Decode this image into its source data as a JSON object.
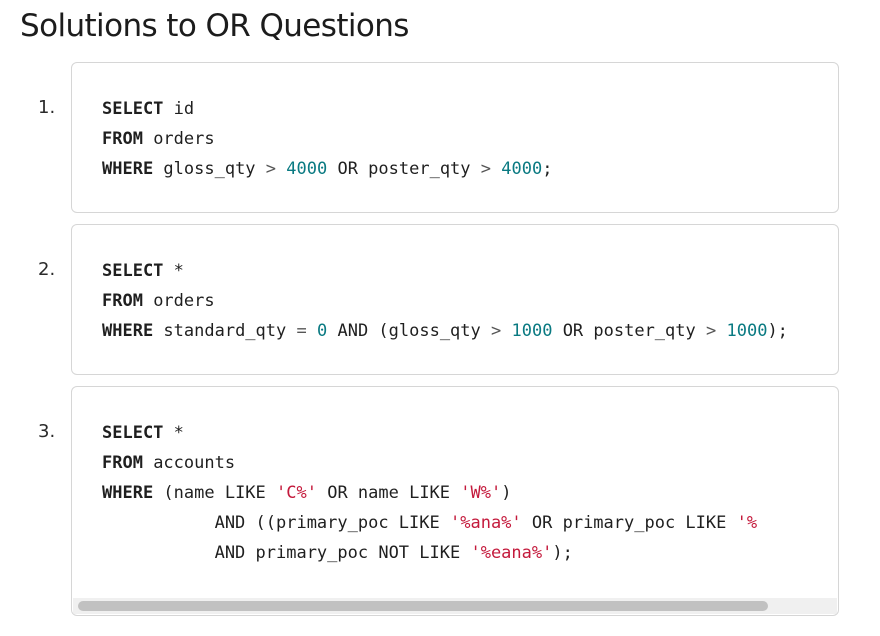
{
  "page": {
    "title": "Solutions to OR Questions"
  },
  "solutions": [
    {
      "number": "1.",
      "lines": [
        [
          {
            "t": "kw",
            "v": "SELECT"
          },
          {
            "t": "p",
            "v": " id"
          }
        ],
        [
          {
            "t": "kw",
            "v": "FROM"
          },
          {
            "t": "p",
            "v": " orders"
          }
        ],
        [
          {
            "t": "kw",
            "v": "WHERE"
          },
          {
            "t": "p",
            "v": " gloss_qty "
          },
          {
            "t": "op",
            "v": ">"
          },
          {
            "t": "p",
            "v": " "
          },
          {
            "t": "num",
            "v": "4000"
          },
          {
            "t": "p",
            "v": " OR poster_qty "
          },
          {
            "t": "op",
            "v": ">"
          },
          {
            "t": "p",
            "v": " "
          },
          {
            "t": "num",
            "v": "4000"
          },
          {
            "t": "p",
            "v": ";"
          }
        ]
      ]
    },
    {
      "number": "2.",
      "lines": [
        [
          {
            "t": "kw",
            "v": "SELECT"
          },
          {
            "t": "p",
            "v": " *"
          }
        ],
        [
          {
            "t": "kw",
            "v": "FROM"
          },
          {
            "t": "p",
            "v": " orders"
          }
        ],
        [
          {
            "t": "kw",
            "v": "WHERE"
          },
          {
            "t": "p",
            "v": " standard_qty "
          },
          {
            "t": "op",
            "v": "="
          },
          {
            "t": "p",
            "v": " "
          },
          {
            "t": "num",
            "v": "0"
          },
          {
            "t": "p",
            "v": " AND (gloss_qty "
          },
          {
            "t": "op",
            "v": ">"
          },
          {
            "t": "p",
            "v": " "
          },
          {
            "t": "num",
            "v": "1000"
          },
          {
            "t": "p",
            "v": " OR poster_qty "
          },
          {
            "t": "op",
            "v": ">"
          },
          {
            "t": "p",
            "v": " "
          },
          {
            "t": "num",
            "v": "1000"
          },
          {
            "t": "p",
            "v": ");"
          }
        ]
      ]
    },
    {
      "number": "3.",
      "lines": [
        [
          {
            "t": "kw",
            "v": "SELECT"
          },
          {
            "t": "p",
            "v": " *"
          }
        ],
        [
          {
            "t": "kw",
            "v": "FROM"
          },
          {
            "t": "p",
            "v": " accounts"
          }
        ],
        [
          {
            "t": "kw",
            "v": "WHERE"
          },
          {
            "t": "p",
            "v": " (name LIKE "
          },
          {
            "t": "str",
            "v": "'C%'"
          },
          {
            "t": "p",
            "v": " OR name LIKE "
          },
          {
            "t": "str",
            "v": "'W%'"
          },
          {
            "t": "p",
            "v": ")"
          }
        ],
        [
          {
            "t": "p",
            "v": "           AND ((primary_poc LIKE "
          },
          {
            "t": "str",
            "v": "'%ana%'"
          },
          {
            "t": "p",
            "v": " OR primary_poc LIKE "
          },
          {
            "t": "str",
            "v": "'%"
          }
        ],
        [
          {
            "t": "p",
            "v": "           AND primary_poc NOT LIKE "
          },
          {
            "t": "str",
            "v": "'%eana%'"
          },
          {
            "t": "p",
            "v": ");"
          }
        ]
      ]
    }
  ],
  "colors": {
    "keyword": "#1f1f1f",
    "number": "#0a7a82",
    "string": "#c41a3c",
    "border": "#d6d6d6",
    "scroll_thumb": "#c1c1c1"
  }
}
